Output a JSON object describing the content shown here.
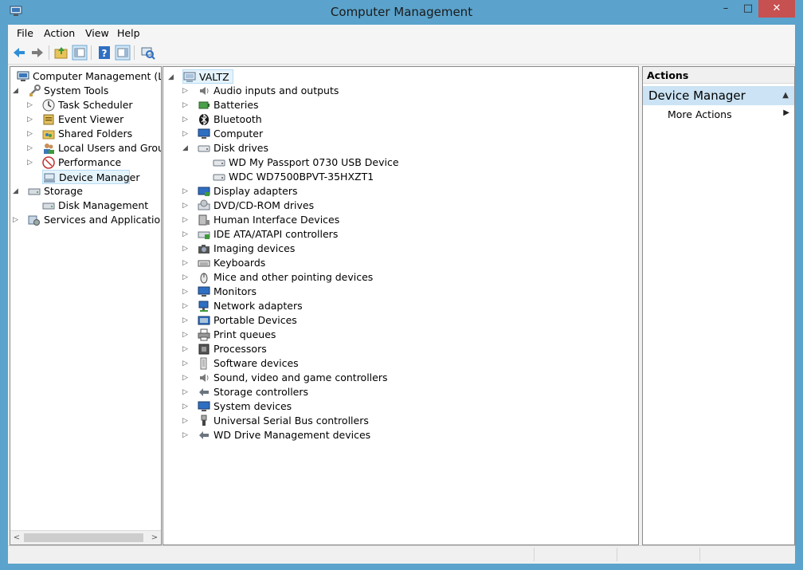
{
  "window": {
    "title": "Computer Management",
    "minimize_glyph": "–",
    "maximize_glyph": "□",
    "close_glyph": "✕"
  },
  "menu": [
    "File",
    "Action",
    "View",
    "Help"
  ],
  "toolbar": {
    "buttons": [
      "back-arrow-icon",
      "forward-arrow-icon",
      "up-folder-icon",
      "show-hide-console-tree-icon",
      "help-icon",
      "show-hide-action-pane-icon",
      "scan-hardware-icon"
    ]
  },
  "left_tree": {
    "items": [
      {
        "label": "Computer Management (Local",
        "icon": "computer-management-icon",
        "expander": ""
      },
      {
        "label": "System Tools",
        "icon": "system-tools-icon",
        "expander": "◢"
      },
      {
        "label": "Task Scheduler",
        "icon": "task-scheduler-icon",
        "expander": "▷"
      },
      {
        "label": "Event Viewer",
        "icon": "event-viewer-icon",
        "expander": "▷"
      },
      {
        "label": "Shared Folders",
        "icon": "shared-folders-icon",
        "expander": "▷"
      },
      {
        "label": "Local Users and Groups",
        "icon": "local-users-icon",
        "expander": "▷"
      },
      {
        "label": "Performance",
        "icon": "performance-icon",
        "expander": "▷"
      },
      {
        "label": "Device Manager",
        "icon": "device-manager-icon",
        "expander": "",
        "selected": true
      },
      {
        "label": "Storage",
        "icon": "storage-icon",
        "expander": "◢"
      },
      {
        "label": "Disk Management",
        "icon": "disk-management-icon",
        "expander": ""
      },
      {
        "label": "Services and Applications",
        "icon": "services-icon",
        "expander": "▷"
      }
    ]
  },
  "device_tree": {
    "root": {
      "label": "VALTZ",
      "icon": "computer-icon",
      "expander": "◢"
    },
    "items": [
      {
        "label": "Audio inputs and outputs",
        "icon": "speaker-icon",
        "expander": "▷"
      },
      {
        "label": "Batteries",
        "icon": "battery-icon",
        "expander": "▷"
      },
      {
        "label": "Bluetooth",
        "icon": "bluetooth-icon",
        "expander": "▷"
      },
      {
        "label": "Computer",
        "icon": "monitor-icon",
        "expander": "▷"
      },
      {
        "label": "Disk drives",
        "icon": "disk-drive-icon",
        "expander": "◢"
      },
      {
        "label": "WD My Passport 0730 USB Device",
        "icon": "disk-drive-icon",
        "expander": "",
        "child": true
      },
      {
        "label": "WDC WD7500BPVT-35HXZT1",
        "icon": "disk-drive-icon",
        "expander": "",
        "child": true
      },
      {
        "label": "Display adapters",
        "icon": "display-adapter-icon",
        "expander": "▷"
      },
      {
        "label": "DVD/CD-ROM drives",
        "icon": "dvd-drive-icon",
        "expander": "▷"
      },
      {
        "label": "Human Interface Devices",
        "icon": "hid-icon",
        "expander": "▷"
      },
      {
        "label": "IDE ATA/ATAPI controllers",
        "icon": "ide-controller-icon",
        "expander": "▷"
      },
      {
        "label": "Imaging devices",
        "icon": "camera-icon",
        "expander": "▷"
      },
      {
        "label": "Keyboards",
        "icon": "keyboard-icon",
        "expander": "▷"
      },
      {
        "label": "Mice and other pointing devices",
        "icon": "mouse-icon",
        "expander": "▷"
      },
      {
        "label": "Monitors",
        "icon": "monitor-icon",
        "expander": "▷"
      },
      {
        "label": "Network adapters",
        "icon": "network-adapter-icon",
        "expander": "▷"
      },
      {
        "label": "Portable Devices",
        "icon": "portable-device-icon",
        "expander": "▷"
      },
      {
        "label": "Print queues",
        "icon": "printer-icon",
        "expander": "▷"
      },
      {
        "label": "Processors",
        "icon": "processor-icon",
        "expander": "▷"
      },
      {
        "label": "Software devices",
        "icon": "software-device-icon",
        "expander": "▷"
      },
      {
        "label": "Sound, video and game controllers",
        "icon": "speaker-icon",
        "expander": "▷"
      },
      {
        "label": "Storage controllers",
        "icon": "storage-controller-icon",
        "expander": "▷"
      },
      {
        "label": "System devices",
        "icon": "system-device-icon",
        "expander": "▷"
      },
      {
        "label": "Universal Serial Bus controllers",
        "icon": "usb-icon",
        "expander": "▷"
      },
      {
        "label": "WD Drive Management devices",
        "icon": "storage-controller-icon",
        "expander": "▷"
      }
    ]
  },
  "actions": {
    "header": "Actions",
    "group": "Device Manager",
    "group_caret": "▲",
    "items": [
      {
        "label": "More Actions",
        "arrow": "▶"
      }
    ]
  },
  "left_scroll": {
    "left_arrow": "<",
    "right_arrow": ">"
  },
  "colors": {
    "titlebar": "#5ba3cc",
    "close_button": "#c75050",
    "selection": "#e5f3fb",
    "action_group": "#cbe3f4"
  }
}
